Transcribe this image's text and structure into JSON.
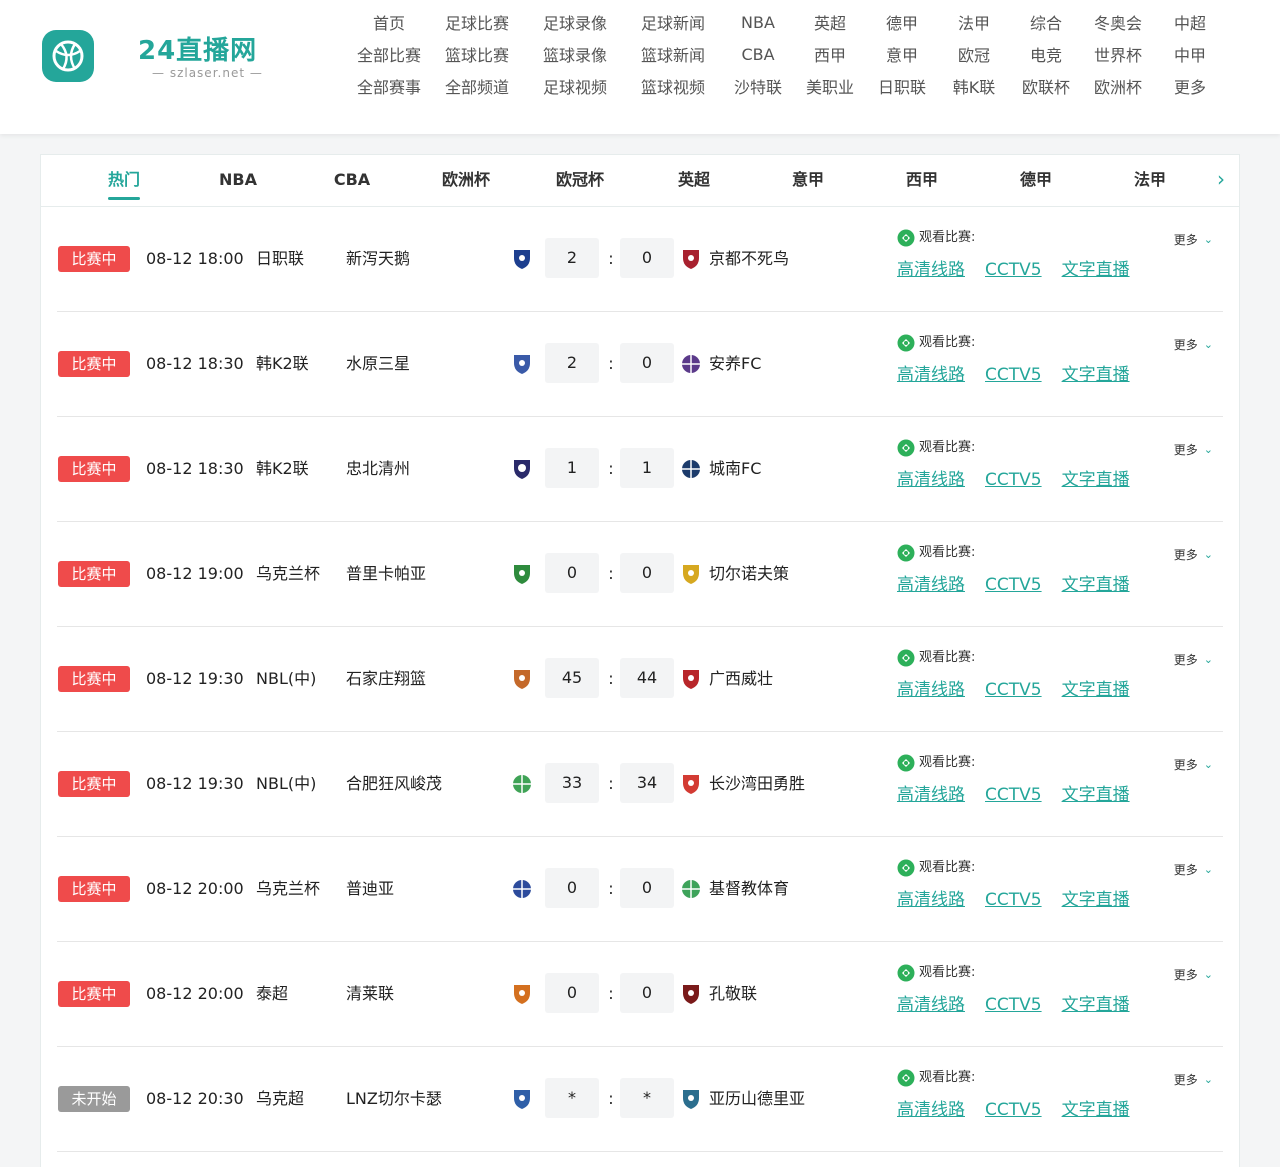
{
  "logo": {
    "title": "24直播网",
    "subtitle": "— szlaser.net —"
  },
  "nav": {
    "rows": [
      [
        "首页",
        "足球比赛",
        "足球录像",
        "足球新闻",
        "NBA",
        "英超",
        "德甲",
        "法甲",
        "综合",
        "冬奥会",
        "中超"
      ],
      [
        "全部比赛",
        "篮球比赛",
        "篮球录像",
        "篮球新闻",
        "CBA",
        "西甲",
        "意甲",
        "欧冠",
        "电竞",
        "世界杯",
        "中甲"
      ],
      [
        "全部赛事",
        "全部频道",
        "足球视频",
        "篮球视频",
        "沙特联",
        "美职业",
        "日职联",
        "韩K联",
        "欧联杯",
        "欧洲杯",
        "更多"
      ]
    ]
  },
  "tabs": [
    "热门",
    "NBA",
    "CBA",
    "欧洲杯",
    "欧冠杯",
    "英超",
    "意甲",
    "西甲",
    "德甲",
    "法甲"
  ],
  "watch_label": "观看比赛:",
  "more_label": "更多",
  "links": [
    "高清线路",
    "CCTV5",
    "文字直播"
  ],
  "colors": {
    "accent": "#24a69a",
    "live": "#ef4b4b",
    "pending": "#9a9a9a"
  },
  "matches": [
    {
      "status": "比赛中",
      "status_type": "live",
      "time": "08-12 18:00",
      "league": "日职联",
      "home": "新泻天鹅",
      "home_score": "2",
      "away_score": "0",
      "away": "京都不死鸟"
    },
    {
      "status": "比赛中",
      "status_type": "live",
      "time": "08-12 18:30",
      "league": "韩K2联",
      "home": "水原三星",
      "home_score": "2",
      "away_score": "0",
      "away": "安养FC"
    },
    {
      "status": "比赛中",
      "status_type": "live",
      "time": "08-12 18:30",
      "league": "韩K2联",
      "home": "忠北清州",
      "home_score": "1",
      "away_score": "1",
      "away": "城南FC"
    },
    {
      "status": "比赛中",
      "status_type": "live",
      "time": "08-12 19:00",
      "league": "乌克兰杯",
      "home": "普里卡帕亚",
      "home_score": "0",
      "away_score": "0",
      "away": "切尔诺夫策"
    },
    {
      "status": "比赛中",
      "status_type": "live",
      "time": "08-12 19:30",
      "league": "NBL(中)",
      "home": "石家庄翔篮",
      "home_score": "45",
      "away_score": "44",
      "away": "广西威壮"
    },
    {
      "status": "比赛中",
      "status_type": "live",
      "time": "08-12 19:30",
      "league": "NBL(中)",
      "home": "合肥狂风峻茂",
      "home_score": "33",
      "away_score": "34",
      "away": "长沙湾田勇胜"
    },
    {
      "status": "比赛中",
      "status_type": "live",
      "time": "08-12 20:00",
      "league": "乌克兰杯",
      "home": "普迪亚",
      "home_score": "0",
      "away_score": "0",
      "away": "基督教体育"
    },
    {
      "status": "比赛中",
      "status_type": "live",
      "time": "08-12 20:00",
      "league": "泰超",
      "home": "清莱联",
      "home_score": "0",
      "away_score": "0",
      "away": "孔敬联"
    },
    {
      "status": "未开始",
      "status_type": "pending",
      "time": "08-12 20:30",
      "league": "乌克超",
      "home": "LNZ切尔卡瑟",
      "home_score": "*",
      "away_score": "*",
      "away": "亚历山德里亚"
    }
  ]
}
